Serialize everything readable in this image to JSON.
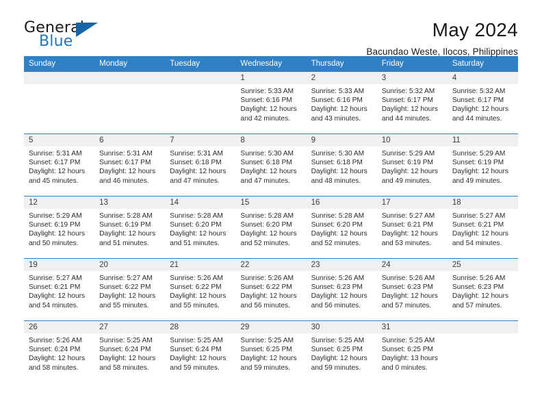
{
  "brand": {
    "name_part1": "General",
    "name_part2": "Blue",
    "triangle_color": "#1565a8",
    "blue_color": "#2077c0"
  },
  "header": {
    "title": "May 2024",
    "subtitle": "Bacundao Weste, Ilocos, Philippines"
  },
  "theme": {
    "header_bg": "#3080c6",
    "daynum_bg": "#f0f0f0",
    "grid_line": "#3080c6"
  },
  "weekday_headers": [
    "Sunday",
    "Monday",
    "Tuesday",
    "Wednesday",
    "Thursday",
    "Friday",
    "Saturday"
  ],
  "weeks": [
    [
      {
        "day": "",
        "lines": []
      },
      {
        "day": "",
        "lines": []
      },
      {
        "day": "",
        "lines": []
      },
      {
        "day": "1",
        "lines": [
          "Sunrise: 5:33 AM",
          "Sunset: 6:16 PM",
          "Daylight: 12 hours",
          "and 42 minutes."
        ]
      },
      {
        "day": "2",
        "lines": [
          "Sunrise: 5:33 AM",
          "Sunset: 6:16 PM",
          "Daylight: 12 hours",
          "and 43 minutes."
        ]
      },
      {
        "day": "3",
        "lines": [
          "Sunrise: 5:32 AM",
          "Sunset: 6:17 PM",
          "Daylight: 12 hours",
          "and 44 minutes."
        ]
      },
      {
        "day": "4",
        "lines": [
          "Sunrise: 5:32 AM",
          "Sunset: 6:17 PM",
          "Daylight: 12 hours",
          "and 44 minutes."
        ]
      }
    ],
    [
      {
        "day": "5",
        "lines": [
          "Sunrise: 5:31 AM",
          "Sunset: 6:17 PM",
          "Daylight: 12 hours",
          "and 45 minutes."
        ]
      },
      {
        "day": "6",
        "lines": [
          "Sunrise: 5:31 AM",
          "Sunset: 6:17 PM",
          "Daylight: 12 hours",
          "and 46 minutes."
        ]
      },
      {
        "day": "7",
        "lines": [
          "Sunrise: 5:31 AM",
          "Sunset: 6:18 PM",
          "Daylight: 12 hours",
          "and 47 minutes."
        ]
      },
      {
        "day": "8",
        "lines": [
          "Sunrise: 5:30 AM",
          "Sunset: 6:18 PM",
          "Daylight: 12 hours",
          "and 47 minutes."
        ]
      },
      {
        "day": "9",
        "lines": [
          "Sunrise: 5:30 AM",
          "Sunset: 6:18 PM",
          "Daylight: 12 hours",
          "and 48 minutes."
        ]
      },
      {
        "day": "10",
        "lines": [
          "Sunrise: 5:29 AM",
          "Sunset: 6:19 PM",
          "Daylight: 12 hours",
          "and 49 minutes."
        ]
      },
      {
        "day": "11",
        "lines": [
          "Sunrise: 5:29 AM",
          "Sunset: 6:19 PM",
          "Daylight: 12 hours",
          "and 49 minutes."
        ]
      }
    ],
    [
      {
        "day": "12",
        "lines": [
          "Sunrise: 5:29 AM",
          "Sunset: 6:19 PM",
          "Daylight: 12 hours",
          "and 50 minutes."
        ]
      },
      {
        "day": "13",
        "lines": [
          "Sunrise: 5:28 AM",
          "Sunset: 6:19 PM",
          "Daylight: 12 hours",
          "and 51 minutes."
        ]
      },
      {
        "day": "14",
        "lines": [
          "Sunrise: 5:28 AM",
          "Sunset: 6:20 PM",
          "Daylight: 12 hours",
          "and 51 minutes."
        ]
      },
      {
        "day": "15",
        "lines": [
          "Sunrise: 5:28 AM",
          "Sunset: 6:20 PM",
          "Daylight: 12 hours",
          "and 52 minutes."
        ]
      },
      {
        "day": "16",
        "lines": [
          "Sunrise: 5:28 AM",
          "Sunset: 6:20 PM",
          "Daylight: 12 hours",
          "and 52 minutes."
        ]
      },
      {
        "day": "17",
        "lines": [
          "Sunrise: 5:27 AM",
          "Sunset: 6:21 PM",
          "Daylight: 12 hours",
          "and 53 minutes."
        ]
      },
      {
        "day": "18",
        "lines": [
          "Sunrise: 5:27 AM",
          "Sunset: 6:21 PM",
          "Daylight: 12 hours",
          "and 54 minutes."
        ]
      }
    ],
    [
      {
        "day": "19",
        "lines": [
          "Sunrise: 5:27 AM",
          "Sunset: 6:21 PM",
          "Daylight: 12 hours",
          "and 54 minutes."
        ]
      },
      {
        "day": "20",
        "lines": [
          "Sunrise: 5:27 AM",
          "Sunset: 6:22 PM",
          "Daylight: 12 hours",
          "and 55 minutes."
        ]
      },
      {
        "day": "21",
        "lines": [
          "Sunrise: 5:26 AM",
          "Sunset: 6:22 PM",
          "Daylight: 12 hours",
          "and 55 minutes."
        ]
      },
      {
        "day": "22",
        "lines": [
          "Sunrise: 5:26 AM",
          "Sunset: 6:22 PM",
          "Daylight: 12 hours",
          "and 56 minutes."
        ]
      },
      {
        "day": "23",
        "lines": [
          "Sunrise: 5:26 AM",
          "Sunset: 6:23 PM",
          "Daylight: 12 hours",
          "and 56 minutes."
        ]
      },
      {
        "day": "24",
        "lines": [
          "Sunrise: 5:26 AM",
          "Sunset: 6:23 PM",
          "Daylight: 12 hours",
          "and 57 minutes."
        ]
      },
      {
        "day": "25",
        "lines": [
          "Sunrise: 5:26 AM",
          "Sunset: 6:23 PM",
          "Daylight: 12 hours",
          "and 57 minutes."
        ]
      }
    ],
    [
      {
        "day": "26",
        "lines": [
          "Sunrise: 5:26 AM",
          "Sunset: 6:24 PM",
          "Daylight: 12 hours",
          "and 58 minutes."
        ]
      },
      {
        "day": "27",
        "lines": [
          "Sunrise: 5:25 AM",
          "Sunset: 6:24 PM",
          "Daylight: 12 hours",
          "and 58 minutes."
        ]
      },
      {
        "day": "28",
        "lines": [
          "Sunrise: 5:25 AM",
          "Sunset: 6:24 PM",
          "Daylight: 12 hours",
          "and 59 minutes."
        ]
      },
      {
        "day": "29",
        "lines": [
          "Sunrise: 5:25 AM",
          "Sunset: 6:25 PM",
          "Daylight: 12 hours",
          "and 59 minutes."
        ]
      },
      {
        "day": "30",
        "lines": [
          "Sunrise: 5:25 AM",
          "Sunset: 6:25 PM",
          "Daylight: 12 hours",
          "and 59 minutes."
        ]
      },
      {
        "day": "31",
        "lines": [
          "Sunrise: 5:25 AM",
          "Sunset: 6:25 PM",
          "Daylight: 13 hours",
          "and 0 minutes."
        ]
      },
      {
        "day": "",
        "lines": []
      }
    ]
  ]
}
